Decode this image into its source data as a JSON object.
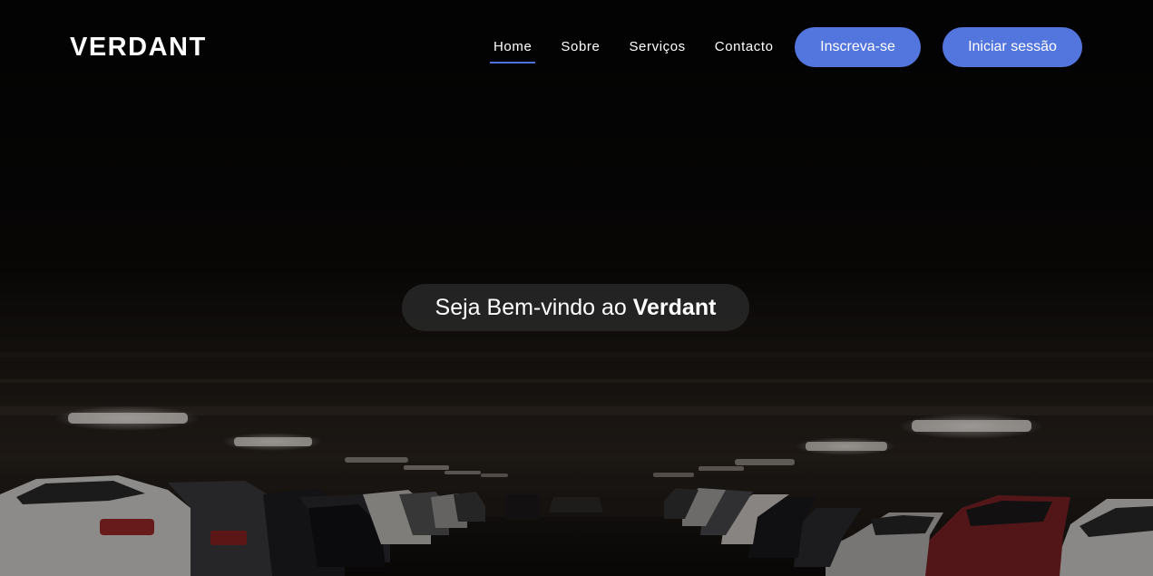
{
  "header": {
    "brand": "VERDANT"
  },
  "nav": {
    "items": [
      {
        "label": "Home",
        "active": true
      },
      {
        "label": "Sobre",
        "active": false
      },
      {
        "label": "Serviços",
        "active": false
      },
      {
        "label": "Contacto",
        "active": false
      }
    ]
  },
  "actions": {
    "signup_label": "Inscreva-se",
    "login_label": "Iniciar sessão"
  },
  "hero": {
    "welcome_text": "Seja Bem-vindo ao",
    "welcome_brand": "Verdant",
    "background_image": "dark underground parking garage with rows of parked cars and ceiling lights"
  },
  "colors": {
    "accent": "#5376de",
    "nav_underline": "#4e72dc",
    "text": "#ffffff",
    "pill_background": "#262626"
  }
}
